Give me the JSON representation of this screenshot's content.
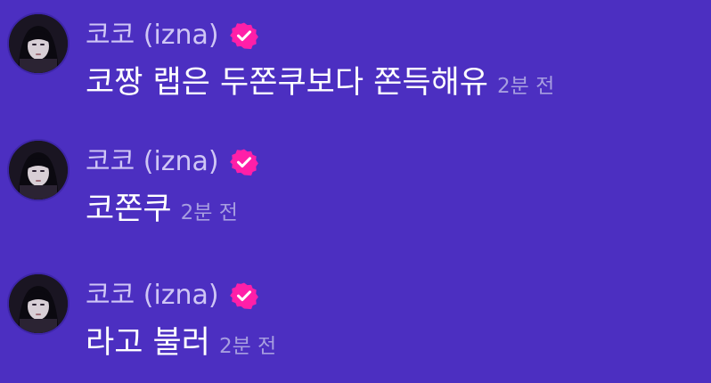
{
  "messages": [
    {
      "author": "코코 (izna)",
      "verified_icon": "verified-badge-icon",
      "text": "코짱 랩은 두쫀쿠보다 쫀득해유",
      "time": "2분 전"
    },
    {
      "author": "코코 (izna)",
      "verified_icon": "verified-badge-icon",
      "text": "코쫀쿠",
      "time": "2분 전"
    },
    {
      "author": "코코 (izna)",
      "verified_icon": "verified-badge-icon",
      "text": "라고 불러",
      "time": "2분 전"
    }
  ],
  "colors": {
    "background": "#4c2fc1",
    "author": "#cfc6f5",
    "message_text": "#ffffff",
    "timestamp": "#a79ee0",
    "verified_badge": "#ff1fa8"
  }
}
